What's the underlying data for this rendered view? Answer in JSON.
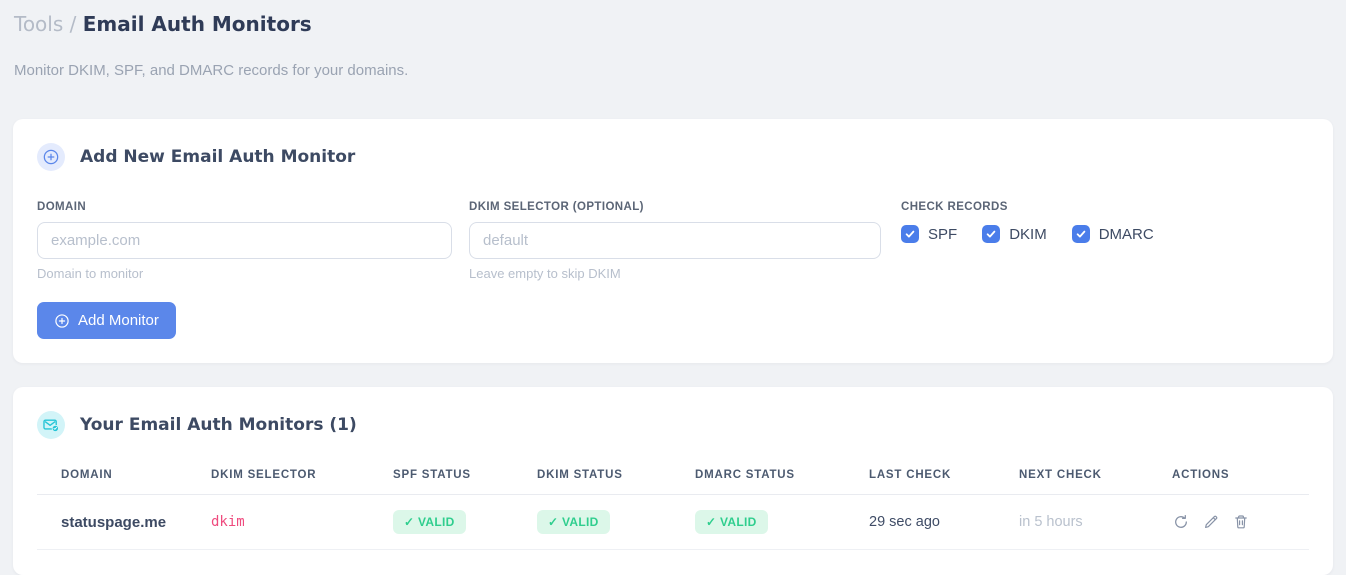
{
  "page": {
    "breadcrumb_parent": "Tools",
    "breadcrumb_separator": "/",
    "title": "Email Auth Monitors",
    "subtitle": "Monitor DKIM, SPF, and DMARC records for your domains."
  },
  "add_monitor_card": {
    "icon": "plus-circle-icon",
    "title": "Add New Email Auth Monitor",
    "fields": {
      "domain": {
        "label": "DOMAIN",
        "placeholder": "example.com",
        "value": "",
        "hint": "Domain to monitor"
      },
      "dkim_selector": {
        "label": "DKIM SELECTOR (OPTIONAL)",
        "placeholder": "default",
        "value": "",
        "hint": "Leave empty to skip DKIM"
      }
    },
    "check_records": {
      "label": "CHECK RECORDS",
      "options": [
        {
          "label": "SPF",
          "checked": true
        },
        {
          "label": "DKIM",
          "checked": true
        },
        {
          "label": "DMARC",
          "checked": true
        }
      ]
    },
    "submit_label": "Add Monitor"
  },
  "monitors_card": {
    "icon": "email-check-icon",
    "title": "Your Email Auth Monitors (1)",
    "table": {
      "columns": [
        "DOMAIN",
        "DKIM SELECTOR",
        "SPF STATUS",
        "DKIM STATUS",
        "DMARC STATUS",
        "LAST CHECK",
        "NEXT CHECK",
        "ACTIONS"
      ],
      "rows": [
        {
          "domain": "statuspage.me",
          "dkim_selector": "dkim",
          "spf_status": "✓ VALID",
          "dkim_status": "✓ VALID",
          "dmarc_status": "✓ VALID",
          "last_check": "29 sec ago",
          "next_check": "in 5 hours",
          "actions": [
            "refresh",
            "edit",
            "delete"
          ]
        }
      ]
    }
  },
  "colors": {
    "accent_blue": "#5b87ea",
    "checkbox_blue": "#4a7dea",
    "badge_green_bg": "#dcf7e9",
    "badge_green_text": "#2fce8e",
    "selector_pink": "#ef4b7e",
    "icon_circle_blue_bg": "#e4ebfd",
    "icon_circle_cyan_bg": "#d2f4f8",
    "icon_cyan": "#25c5d6",
    "page_background": "#f0f2f5"
  }
}
